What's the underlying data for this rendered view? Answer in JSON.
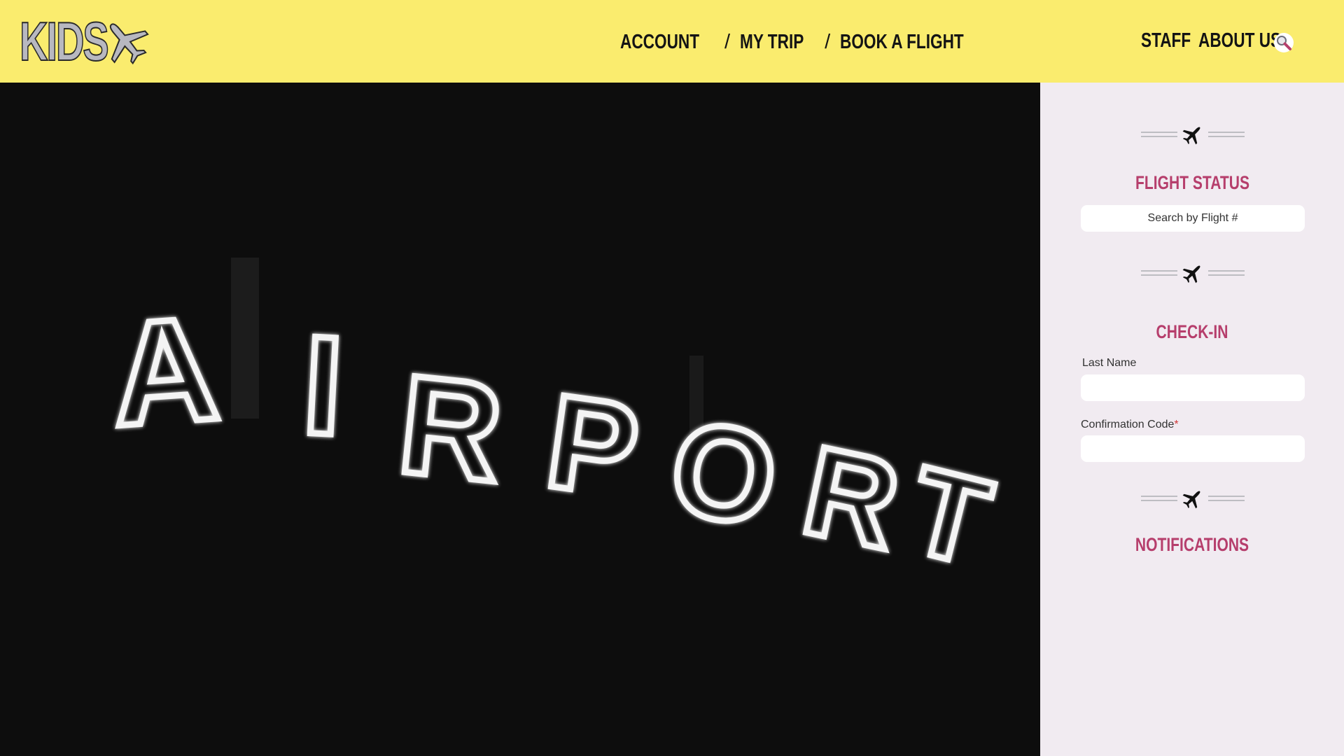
{
  "header": {
    "logo_text": "KIDS",
    "nav": {
      "account": "ACCOUNT",
      "my_trip": "MY TRIP",
      "book_flight": "BOOK A FLIGHT",
      "separator": "/"
    },
    "right_nav": {
      "staff": "STAFF",
      "about": "ABOUT US"
    },
    "search_icon": "search-icon",
    "accent_color": "#faec6e"
  },
  "hero": {
    "sign_text": "AIRPORT",
    "letters": [
      "A",
      "I",
      "R",
      "P",
      "O",
      "R",
      "T"
    ]
  },
  "sidebar": {
    "background": "#f1ebf1",
    "title_color": "#b63e6c",
    "flight_status": {
      "title": "FLIGHT STATUS",
      "placeholder": "Search by Flight #"
    },
    "check_in": {
      "title": "CHECK-IN",
      "last_name_label": "Last Name",
      "confirmation_label": "Confirmation Code",
      "required_mark": "*"
    },
    "notifications": {
      "title": "NOTIFICATIONS"
    }
  }
}
